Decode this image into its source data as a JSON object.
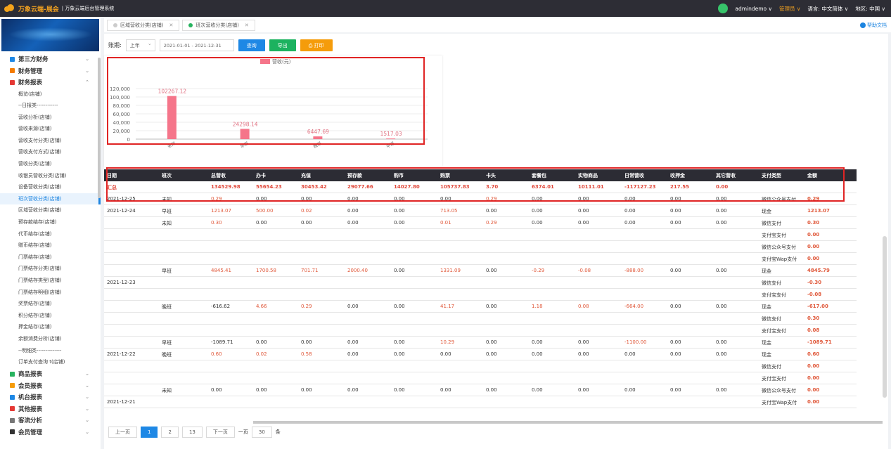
{
  "topbar": {
    "brand": "万象云端-展会",
    "subtitle": "| 万象云端后台管理系统",
    "user": "admindemo ∨",
    "role": "管理员 ∨",
    "lang": "语言: 中文简体 ∨",
    "region": "地区: 中国 ∨"
  },
  "sidebar": {
    "groups_top": [
      {
        "label": "第三方财务",
        "color": "#1e88e5"
      },
      {
        "label": "财务管理",
        "color": "#f57c00"
      },
      {
        "label": "财务报表",
        "color": "#e53935"
      }
    ],
    "subs": [
      "概览(店铺)",
      "--日报类------------",
      "营收分析(店铺)",
      "营收来源(店铺)",
      "营收支付分类(店铺)",
      "营收支付方式(店铺)",
      "营收分类(店铺)",
      "收银员营收分类(店铺)",
      "设备营收分类(店铺)",
      "班次营收分类(店铺)",
      "区域营收分类(店铺)",
      "预存款结存(店铺)",
      "代币结存(店铺)",
      "赠币结存(店铺)",
      "门票结存(店铺)",
      "门票结存分类(店铺)",
      "门票结存类型(店铺)",
      "门票结存明细(店铺)",
      "奖票结存(店铺)",
      "积分结存(店铺)",
      "押金结存(店铺)",
      "余额消费分析(店铺)",
      "--明细类--------------",
      "订单支付查询 t(店铺)"
    ],
    "groups_bottom": [
      {
        "label": "商品报表",
        "color": "#27b35f"
      },
      {
        "label": "会员报表",
        "color": "#f59c0b"
      },
      {
        "label": "机台报表",
        "color": "#1e88e5"
      },
      {
        "label": "其他报表",
        "color": "#e53935"
      },
      {
        "label": "客流分析",
        "color": "#777"
      },
      {
        "label": "会员管理",
        "color": "#333"
      }
    ]
  },
  "tabs": [
    {
      "label": "区域营收分类(店铺)"
    },
    {
      "label": "班次营收分类(店铺)"
    }
  ],
  "help": "帮助文档",
  "filters": {
    "label": "账期:",
    "period": "上年",
    "range": "2021-01-01 - 2021-12-31",
    "query": "查询",
    "export": "导出",
    "print": "⎙ 打印"
  },
  "chart_data": {
    "type": "bar",
    "legend": "营收(元)",
    "categories": [
      "未知",
      "早班",
      "晚班",
      "中班"
    ],
    "values": [
      102267.12,
      24298.14,
      6447.69,
      1517.03
    ],
    "ylim": [
      0,
      120000
    ],
    "yticks": [
      "0",
      "20,000",
      "40,000",
      "60,000",
      "80,000",
      "100,000",
      "120,000"
    ],
    "color": "#f5758a"
  },
  "columns": [
    "日期",
    "班次",
    "总营收",
    "办卡",
    "充值",
    "预存款",
    "购币",
    "购票",
    "卡头",
    "套餐包",
    "实物商品",
    "日常营收",
    "收押金",
    "其它营收",
    "支付类型",
    "金额"
  ],
  "summary": [
    "汇总",
    "",
    "134529.98",
    "55654.23",
    "30453.42",
    "29077.66",
    "14027.80",
    "105737.83",
    "3.70",
    "6374.01",
    "10111.01",
    "-117127.23",
    "217.55",
    "0.00",
    "",
    ""
  ],
  "rows": [
    [
      "2021-12-25",
      "未知",
      "0.29",
      "0.00",
      "0.00",
      "0.00",
      "0.00",
      "0.00",
      "0.29",
      "0.00",
      "0.00",
      "0.00",
      "0.00",
      "0.00",
      "微信公众号支付",
      "0.29"
    ],
    [
      "2021-12-24",
      "早班",
      "1213.07",
      "500.00",
      "0.02",
      "0.00",
      "0.00",
      "713.05",
      "0.00",
      "0.00",
      "0.00",
      "0.00",
      "0.00",
      "0.00",
      "现金",
      "1213.07"
    ],
    [
      "",
      "未知",
      "0.30",
      "0.00",
      "0.00",
      "0.00",
      "0.00",
      "0.01",
      "0.29",
      "0.00",
      "0.00",
      "0.00",
      "0.00",
      "0.00",
      "微信支付",
      "0.30"
    ],
    [
      "",
      "",
      "",
      "",
      "",
      "",
      "",
      "",
      "",
      "",
      "",
      "",
      "",
      "",
      "支付宝支付",
      "0.00"
    ],
    [
      "",
      "",
      "",
      "",
      "",
      "",
      "",
      "",
      "",
      "",
      "",
      "",
      "",
      "",
      "微信公众号支付",
      "0.00"
    ],
    [
      "",
      "",
      "",
      "",
      "",
      "",
      "",
      "",
      "",
      "",
      "",
      "",
      "",
      "",
      "支付宝Wap支付",
      "0.00"
    ],
    [
      "",
      "早班",
      "4845.41",
      "1700.58",
      "701.71",
      "2000.40",
      "0.00",
      "1331.09",
      "0.00",
      "-0.29",
      "-0.08",
      "-888.00",
      "0.00",
      "0.00",
      "现金",
      "4845.79"
    ],
    [
      "2021-12-23",
      "",
      "",
      "",
      "",
      "",
      "",
      "",
      "",
      "",
      "",
      "",
      "",
      "",
      "微信支付",
      "-0.30"
    ],
    [
      "",
      "",
      "",
      "",
      "",
      "",
      "",
      "",
      "",
      "",
      "",
      "",
      "",
      "",
      "支付宝支付",
      "-0.08"
    ],
    [
      "",
      "晚班",
      "-616.62",
      "4.66",
      "0.29",
      "0.00",
      "0.00",
      "41.17",
      "0.00",
      "1.18",
      "0.08",
      "-664.00",
      "0.00",
      "0.00",
      "现金",
      "-617.00"
    ],
    [
      "",
      "",
      "",
      "",
      "",
      "",
      "",
      "",
      "",
      "",
      "",
      "",
      "",
      "",
      "微信支付",
      "0.30"
    ],
    [
      "",
      "",
      "",
      "",
      "",
      "",
      "",
      "",
      "",
      "",
      "",
      "",
      "",
      "",
      "支付宝支付",
      "0.08"
    ],
    [
      "",
      "早班",
      "-1089.71",
      "0.00",
      "0.00",
      "0.00",
      "0.00",
      "10.29",
      "0.00",
      "0.00",
      "0.00",
      "-1100.00",
      "0.00",
      "0.00",
      "现金",
      "-1089.71"
    ],
    [
      "2021-12-22",
      "晚班",
      "0.60",
      "0.02",
      "0.58",
      "0.00",
      "0.00",
      "0.00",
      "0.00",
      "0.00",
      "0.00",
      "0.00",
      "0.00",
      "0.00",
      "现金",
      "0.60"
    ],
    [
      "",
      "",
      "",
      "",
      "",
      "",
      "",
      "",
      "",
      "",
      "",
      "",
      "",
      "",
      "微信支付",
      "0.00"
    ],
    [
      "",
      "",
      "",
      "",
      "",
      "",
      "",
      "",
      "",
      "",
      "",
      "",
      "",
      "",
      "支付宝支付",
      "0.00"
    ],
    [
      "",
      "未知",
      "0.00",
      "0.00",
      "0.00",
      "0.00",
      "0.00",
      "0.00",
      "0.00",
      "0.00",
      "0.00",
      "0.00",
      "0.00",
      "0.00",
      "微信公众号支付",
      "0.00"
    ],
    [
      "2021-12-21",
      "",
      "",
      "",
      "",
      "",
      "",
      "",
      "",
      "",
      "",
      "",
      "",
      "",
      "支付宝Wap支付",
      "0.00"
    ]
  ],
  "pager": {
    "prev": "上一页",
    "p1": "1",
    "p2": "2",
    "p3": "13",
    "next": "下一页",
    "per_label": "一页",
    "per": "30",
    "unit": "条"
  }
}
